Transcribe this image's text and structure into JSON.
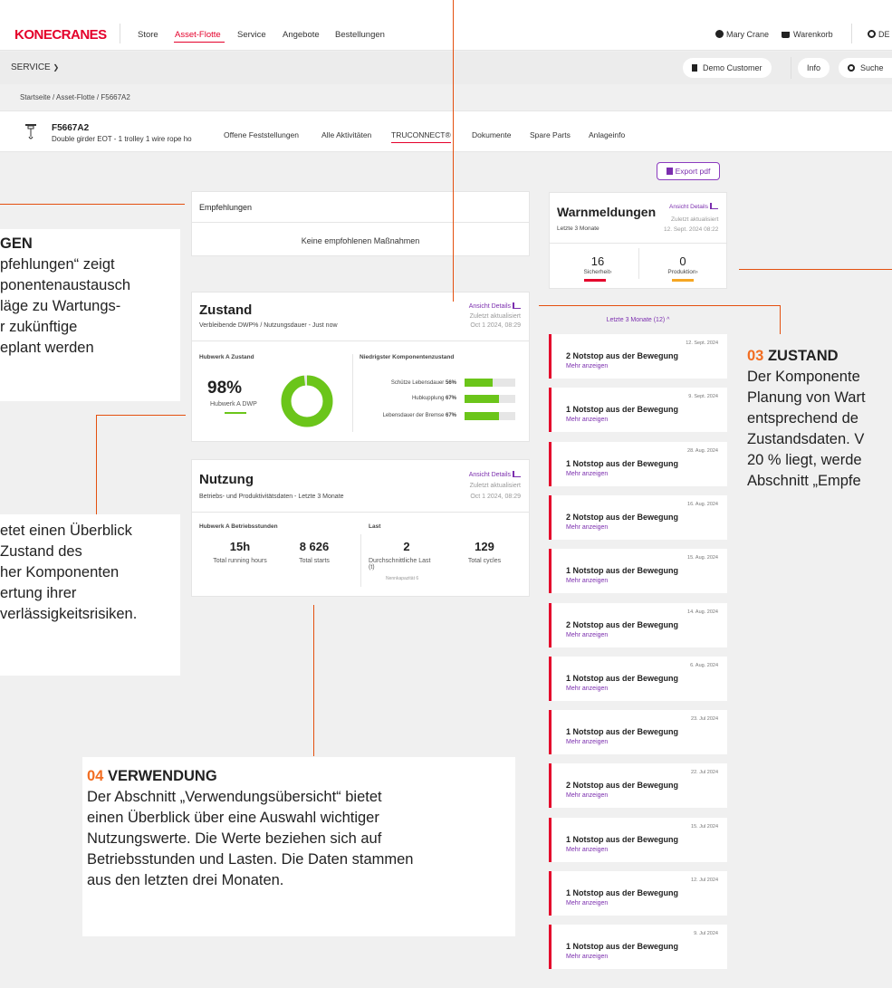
{
  "topnav": {
    "logo": "KONECRANES",
    "items": [
      "Store",
      "Asset-Flotte",
      "Service",
      "Angebote",
      "Bestellungen"
    ],
    "active_index": 1,
    "user": "Mary Crane",
    "cart": "Warenkorb",
    "lang": "DE"
  },
  "servicebar": {
    "label": "SERVICE",
    "customer": "Demo Customer",
    "info": "Info",
    "search": "Suche"
  },
  "breadcrumb": "Startseite / Asset-Flotte / F5667A2",
  "asset": {
    "id": "F5667A2",
    "description": "Double girder EOT - 1 trolley 1 wire rope ho",
    "tabs": [
      "Offene Feststellungen",
      "Alle Aktivitäten",
      "TRUCONNECT®",
      "Dokumente",
      "Spare Parts",
      "Anlageinfo"
    ],
    "active_tab": 2
  },
  "export_label": "Export pdf",
  "empfehlungen": {
    "title": "Empfehlungen",
    "empty": "Keine empfohlenen Maßnahmen"
  },
  "zustand": {
    "title": "Zustand",
    "subtitle": "Verbleibende DWP% / Nutzungsdauer - Just now",
    "details_link": "Ansicht Details",
    "updated_label": "Zuletzt aktualisiert",
    "updated_date": "Oct 1 2024, 08:29",
    "left_header": "Hubwerk A Zustand",
    "percent": "98%",
    "percent_value": 98,
    "percent_label": "Hubwerk A DWP",
    "right_header": "Niedrigster Komponentenzustand",
    "components": [
      {
        "label": "Schütze Lebensdauer",
        "value": "56%",
        "fraction": 0.56
      },
      {
        "label": "Hubkupplung",
        "value": "67%",
        "fraction": 0.67
      },
      {
        "label": "Lebensdauer der Bremse",
        "value": "67%",
        "fraction": 0.67
      }
    ]
  },
  "nutzung": {
    "title": "Nutzung",
    "subtitle": "Betriebs- und Produktivitätsdaten - Letzte 3 Monate",
    "details_link": "Ansicht Details",
    "updated_label": "Zuletzt aktualisiert",
    "updated_date": "Oct 1 2024, 08:29",
    "left_header": "Hubwerk A Betriebsstunden",
    "right_header": "Last",
    "running_hours": "15h",
    "running_hours_label": "Total running hours",
    "starts": "8 626",
    "starts_label": "Total starts",
    "avg_load": "2",
    "avg_load_label": "Durchschnittliche Last (t)",
    "rated_capacity": "Nennkapazität 6",
    "cycles": "129",
    "cycles_label": "Total cycles"
  },
  "warnmeldungen": {
    "title": "Warnmeldungen",
    "period": "Letzte 3 Monate",
    "details_link": "Ansicht Details",
    "updated_label": "Zuletzt aktualisiert",
    "updated_date": "12. Sept. 2024 08:22",
    "safety_count": "16",
    "safety_label": "Sicherheit",
    "production_count": "0",
    "production_label": "Produktion",
    "filter": "Letzte 3 Monate (12)",
    "items": [
      {
        "date": "12. Sept. 2024",
        "title": "2 Notstop aus der Bewegung",
        "more": "Mehr anzeigen"
      },
      {
        "date": "9. Sept. 2024",
        "title": "1 Notstop aus der Bewegung",
        "more": "Mehr anzeigen"
      },
      {
        "date": "28. Aug. 2024",
        "title": "1 Notstop aus der Bewegung",
        "more": "Mehr anzeigen"
      },
      {
        "date": "16. Aug. 2024",
        "title": "2 Notstop aus der Bewegung",
        "more": "Mehr anzeigen"
      },
      {
        "date": "15. Aug. 2024",
        "title": "1 Notstop aus der Bewegung",
        "more": "Mehr anzeigen"
      },
      {
        "date": "14. Aug. 2024",
        "title": "2 Notstop aus der Bewegung",
        "more": "Mehr anzeigen"
      },
      {
        "date": "6. Aug. 2024",
        "title": "1 Notstop aus der Bewegung",
        "more": "Mehr anzeigen"
      },
      {
        "date": "23. Jul 2024",
        "title": "1 Notstop aus der Bewegung",
        "more": "Mehr anzeigen"
      },
      {
        "date": "22. Jul 2024",
        "title": "2 Notstop aus der Bewegung",
        "more": "Mehr anzeigen"
      },
      {
        "date": "15. Jul 2024",
        "title": "1 Notstop aus der Bewegung",
        "more": "Mehr anzeigen"
      },
      {
        "date": "12. Jul 2024",
        "title": "1 Notstop aus der Bewegung",
        "more": "Mehr anzeigen"
      },
      {
        "date": "9. Jul 2024",
        "title": "1 Notstop aus der Bewegung",
        "more": "Mehr anzeigen"
      }
    ]
  },
  "annotations": {
    "empfehlungen": {
      "title": "GEN",
      "lines": [
        "pfehlungen“ zeigt",
        "ponentenaustausch",
        "läge zu Wartungs-",
        "r zukünftige",
        "eplant werden"
      ]
    },
    "left": {
      "lines": [
        "etet einen Überblick",
        "Zustand des",
        "her Komponenten",
        "ertung ihrer",
        "verlässigkeitsrisiken."
      ]
    },
    "zustand": {
      "num": "03",
      "title": "ZUSTAND",
      "lines": [
        "Der Komponente",
        "Planung von Wart",
        "entsprechend de",
        "Zustandsdaten. V",
        "20 % liegt, werde",
        "Abschnitt „Empfe"
      ]
    },
    "verwendung": {
      "num": "04",
      "title": "VERWENDUNG",
      "lines": [
        "Der Abschnitt „Verwendungsübersicht“ bietet",
        "einen Überblick über eine Auswahl wichtiger",
        "Nutzungswerte. Die Werte beziehen sich auf",
        "Betriebsstunden und Lasten. Die Daten stammen",
        "aus den letzten drei Monaten."
      ]
    }
  },
  "colors": {
    "brand": "#e4002b",
    "accent_purple": "#7b2eae",
    "gauge_green": "#6bc51a",
    "annotation_orange": "#f26d21"
  }
}
